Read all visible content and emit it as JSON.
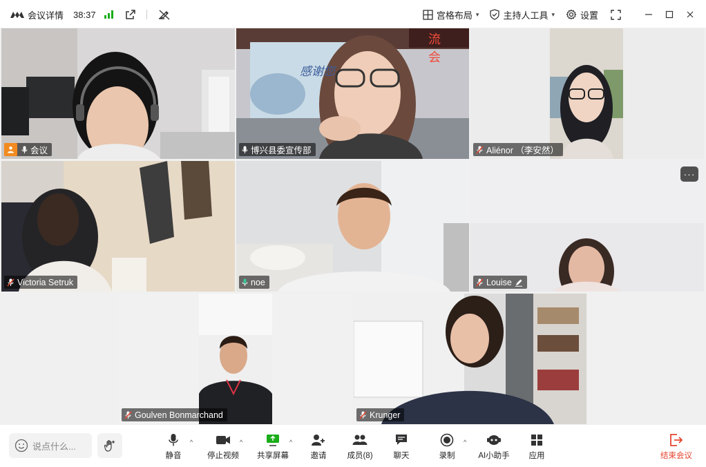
{
  "titlebar": {
    "meeting_info": "会议详情",
    "elapsed": "38:37",
    "layout_label": "宫格布局",
    "host_tools_label": "主持人工具",
    "settings_label": "设置"
  },
  "participants": [
    {
      "name": "会议",
      "mic": "on",
      "host": true
    },
    {
      "name": "博兴县委宣传部",
      "mic": "on"
    },
    {
      "name": "Aliénor （李安然）",
      "mic": "muted"
    },
    {
      "name": "Victoria Setruk",
      "mic": "muted"
    },
    {
      "name": "noe",
      "mic": "speaking",
      "active": true
    },
    {
      "name": "Louise",
      "mic": "muted",
      "edit_icon": true
    },
    {
      "name": "Goulven Bonmarchand",
      "mic": "muted"
    },
    {
      "name": "Krunger",
      "mic": "muted"
    }
  ],
  "screen_text": {
    "banner": "流 会",
    "slide": "感谢您"
  },
  "toolbar": {
    "chat_placeholder": "说点什么...",
    "mute": "静音",
    "stop_video": "停止视频",
    "share_screen": "共享屏幕",
    "invite": "邀请",
    "members": "成员(8)",
    "chat": "聊天",
    "record": "录制",
    "ai_assistant": "AI小助手",
    "apps": "应用",
    "end_meeting": "结束会议"
  },
  "colors": {
    "accent_green": "#3cc397",
    "signal_green": "#1aad19",
    "end_red": "#e5462f",
    "host_orange": "#f28a1f"
  }
}
